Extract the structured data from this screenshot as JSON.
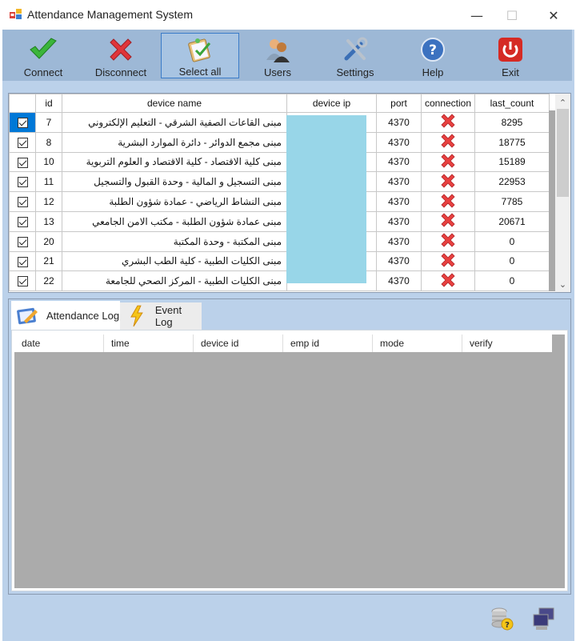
{
  "window": {
    "title": "Attendance Management System",
    "controls": {
      "minimize": "—",
      "maximize": "☐",
      "close": "✕"
    }
  },
  "toolbar": {
    "buttons": [
      {
        "label": "Connect",
        "icon": "check-icon",
        "selected": false
      },
      {
        "label": "Disconnect",
        "icon": "red-x-icon",
        "selected": false
      },
      {
        "label": "Select all",
        "icon": "clipboard-check-icon",
        "selected": true
      },
      {
        "label": "Users",
        "icon": "users-icon",
        "selected": false
      },
      {
        "label": "Settings",
        "icon": "tools-icon",
        "selected": false
      },
      {
        "label": "Help",
        "icon": "help-icon",
        "selected": false
      },
      {
        "label": "Exit",
        "icon": "power-icon",
        "selected": false
      }
    ]
  },
  "devices": {
    "columns": [
      "",
      "id",
      "device name",
      "device ip",
      "port",
      "connection",
      "last_count"
    ],
    "rows": [
      {
        "checked": true,
        "id": "7",
        "name": "مبنى القاعات الصفية الشرقي - التعليم الإلكتروني",
        "ip": "",
        "port": "4370",
        "connection": "disconnected",
        "last_count": "8295"
      },
      {
        "checked": true,
        "id": "8",
        "name": "مبنى مجمع الدوائر - دائرة الموارد البشرية",
        "ip": "",
        "port": "4370",
        "connection": "disconnected",
        "last_count": "18775"
      },
      {
        "checked": true,
        "id": "10",
        "name": "مبنى كلية الاقتصاد - كلية الاقتصاد و العلوم التربوية",
        "ip": "",
        "port": "4370",
        "connection": "disconnected",
        "last_count": "15189"
      },
      {
        "checked": true,
        "id": "11",
        "name": "مبنى التسجيل و المالية - وحدة القبول والتسجيل",
        "ip": "",
        "port": "4370",
        "connection": "disconnected",
        "last_count": "22953"
      },
      {
        "checked": true,
        "id": "12",
        "name": "مبنى النشاط الرياضي - عمادة شؤون الطلبة",
        "ip": "",
        "port": "4370",
        "connection": "disconnected",
        "last_count": "7785"
      },
      {
        "checked": true,
        "id": "13",
        "name": "مبنى عمادة شؤون الطلبة - مكتب الامن الجامعي",
        "ip": "",
        "port": "4370",
        "connection": "disconnected",
        "last_count": "20671"
      },
      {
        "checked": true,
        "id": "20",
        "name": "مبنى المكتبة - وحدة المكتبة",
        "ip": "",
        "port": "4370",
        "connection": "disconnected",
        "last_count": "0"
      },
      {
        "checked": true,
        "id": "21",
        "name": "مبنى الكليات الطبية - كلية الطب البشري",
        "ip": "",
        "port": "4370",
        "connection": "disconnected",
        "last_count": "0"
      },
      {
        "checked": true,
        "id": "22",
        "name": "مبنى الكليات الطبية - المركز الصحي للجامعة",
        "ip": "",
        "port": "4370",
        "connection": "disconnected",
        "last_count": "0"
      }
    ]
  },
  "tabs": [
    {
      "label": "Attendance Log",
      "icon": "notepad-pencil-icon",
      "active": true
    },
    {
      "label": "Event Log",
      "icon": "lightning-icon",
      "active": false
    }
  ],
  "attendance_log": {
    "columns": [
      "date",
      "time",
      "device id",
      "emp id",
      "mode",
      "verify"
    ],
    "rows": []
  },
  "statusbar": {
    "icons": [
      "database-help-icon",
      "network-computers-icon"
    ]
  },
  "colors": {
    "toolbar_bg": "#9db8d6",
    "form_bg": "#bbd1ea",
    "selection": "#0078d7",
    "ip_mask": "#98d6e8",
    "empty_grid": "#ababab"
  }
}
